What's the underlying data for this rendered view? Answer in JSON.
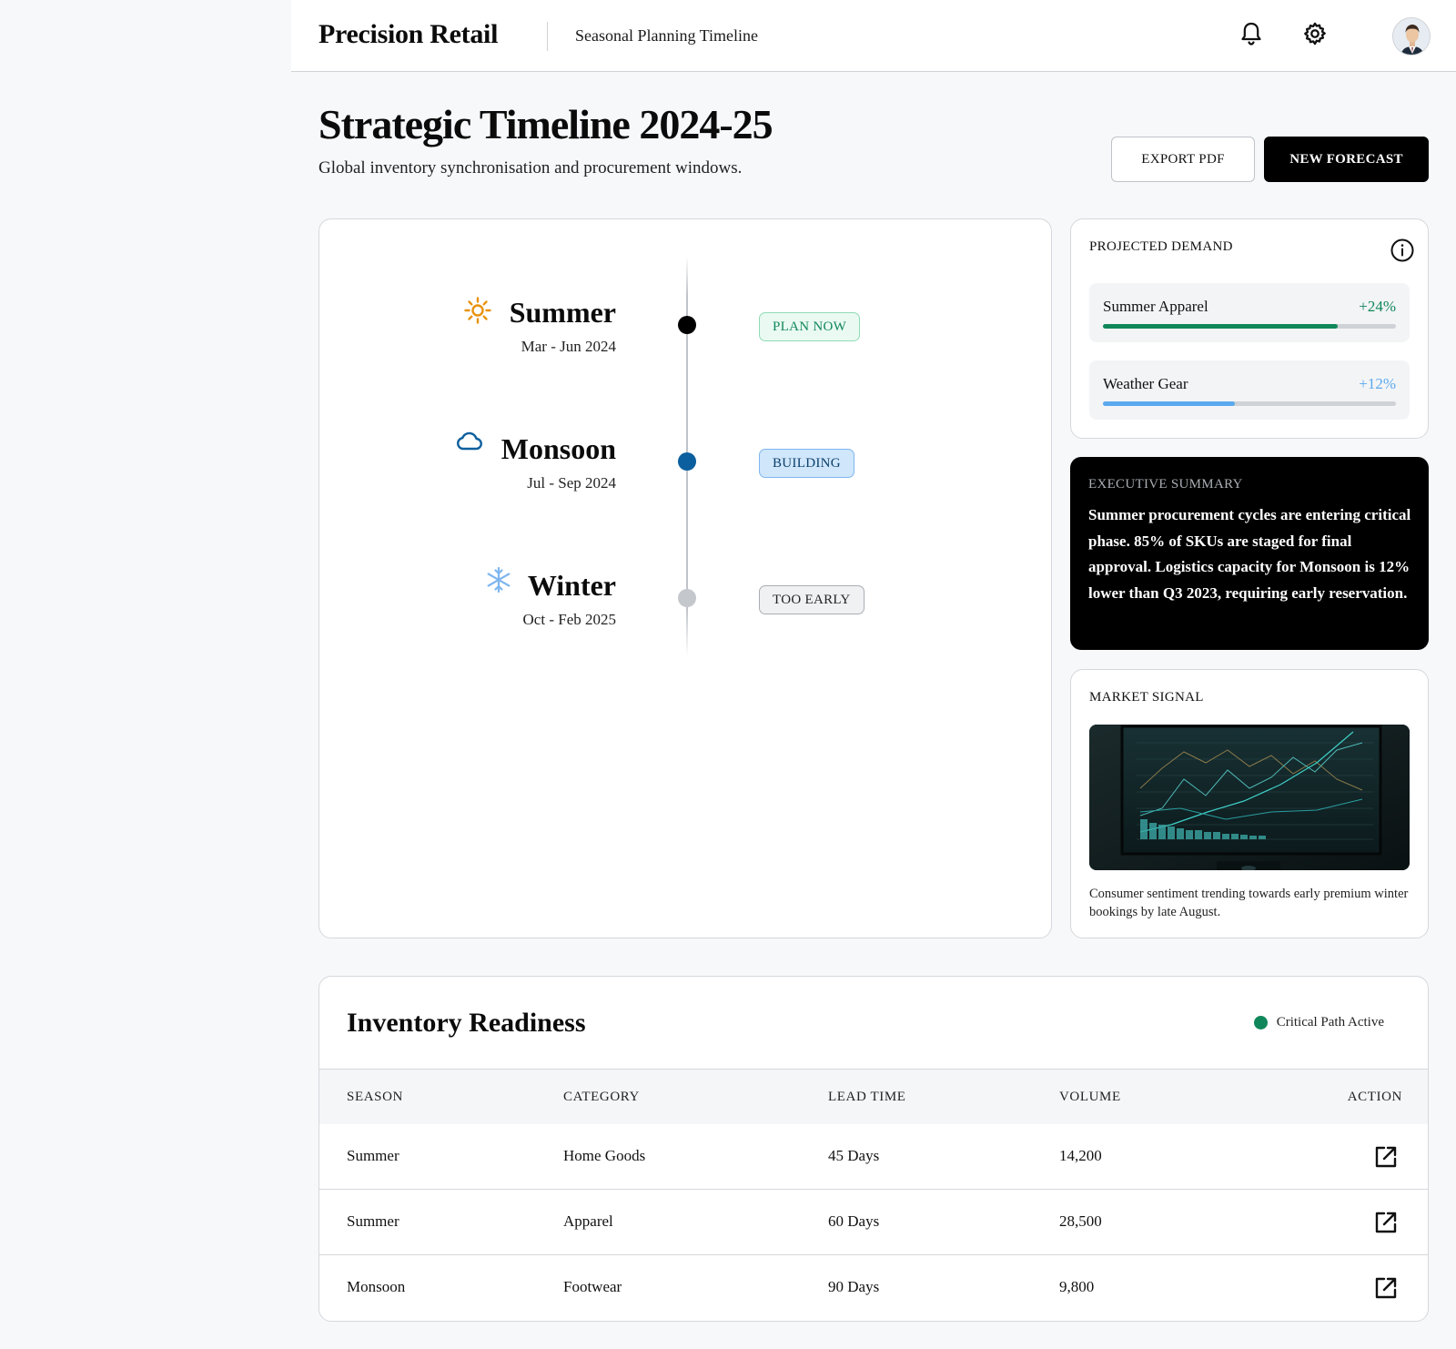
{
  "header": {
    "brand": "Precision Retail",
    "page_name": "Seasonal Planning Timeline",
    "icons": [
      "bell-icon",
      "gear-icon",
      "avatar"
    ]
  },
  "page": {
    "title": "Strategic Timeline 2024-25",
    "description": "Global inventory synchronisation and procurement windows.",
    "export_label": "EXPORT PDF",
    "forecast_label": "NEW FORECAST"
  },
  "timeline": {
    "seasons": [
      {
        "name": "Summer",
        "range": "Mar - Jun 2024",
        "status": "PLAN NOW",
        "icon": "sun-icon",
        "dot_color": "#000000",
        "icon_color": "#e8920e"
      },
      {
        "name": "Monsoon",
        "range": "Jul - Sep 2024",
        "status": "BUILDING",
        "icon": "cloud-icon",
        "dot_color": "#0b5f9e",
        "icon_color": "#0b5f9e"
      },
      {
        "name": "Winter",
        "range": "Oct - Feb 2025",
        "status": "TOO EARLY",
        "icon": "snowflake-icon",
        "dot_color": "#c4c7cc",
        "icon_color": "#7fb6ee"
      }
    ]
  },
  "demand": {
    "label": "PROJECTED DEMAND",
    "items": [
      {
        "name": "Summer Apparel",
        "value": "+24%",
        "progress": 0.8,
        "color": "#10875a"
      },
      {
        "name": "Weather Gear",
        "value": "+12%",
        "progress": 0.45,
        "color": "#5aa9ef"
      }
    ]
  },
  "summary": {
    "label": "EXECUTIVE SUMMARY",
    "text": "Summer procurement cycles are entering critical phase. 85% of SKUs are staged for final approval. Logistics capacity for Monsoon is 12% lower than Q3 2023, requiring early reservation."
  },
  "signal": {
    "label": "MARKET SIGNAL",
    "caption": "Consumer sentiment trending towards early premium winter bookings by late August."
  },
  "inventory": {
    "title": "Inventory Readiness",
    "status": "Critical Path Active",
    "columns": [
      "SEASON",
      "CATEGORY",
      "LEAD TIME",
      "VOLUME",
      "ACTION"
    ],
    "rows": [
      {
        "season": "Summer",
        "category": "Home Goods",
        "lead_time": "45 Days",
        "volume": "14,200"
      },
      {
        "season": "Summer",
        "category": "Apparel",
        "lead_time": "60 Days",
        "volume": "28,500"
      },
      {
        "season": "Monsoon",
        "category": "Footwear",
        "lead_time": "90 Days",
        "volume": "9,800"
      }
    ]
  }
}
